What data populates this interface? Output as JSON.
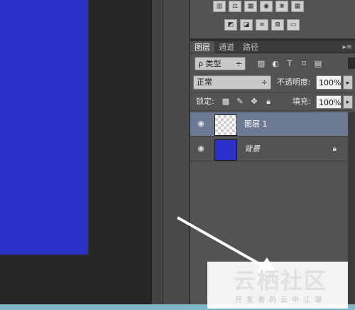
{
  "adjustments": {
    "row1_icons": [
      "levels-icon",
      "balance-icon",
      "color-balance-icon",
      "camera-icon",
      "channel-mixer-icon",
      "grid-icon"
    ],
    "row2_icons": [
      "invert-icon",
      "posterize-icon",
      "threshold-icon",
      "selective-color-icon",
      "gradient-map-icon"
    ]
  },
  "tabs": [
    {
      "label": "图层",
      "active": true
    },
    {
      "label": "通道",
      "active": false
    },
    {
      "label": "路径",
      "active": false
    }
  ],
  "tab_menu": "▸≡",
  "filter": {
    "label": "ρ 类型",
    "arrow": "÷"
  },
  "blend": {
    "mode": "正常",
    "arrow": "÷"
  },
  "opacity": {
    "label": "不透明度:",
    "value": "100%"
  },
  "lock": {
    "label": "锁定:"
  },
  "fill": {
    "label": "填充:",
    "value": "100%"
  },
  "layers": [
    {
      "name": "图层 1",
      "selected": true,
      "thumb": "transparent",
      "locked": false
    },
    {
      "name": "背景",
      "selected": false,
      "thumb": "#2b31c8",
      "locked": true
    }
  ],
  "watermark": {
    "title": "云栖社区",
    "subtitle": "开发者的云中江湖"
  },
  "colors": {
    "canvas_fill": "#2b31c8",
    "panel": "#535353",
    "selected_layer": "#6c7a93"
  }
}
